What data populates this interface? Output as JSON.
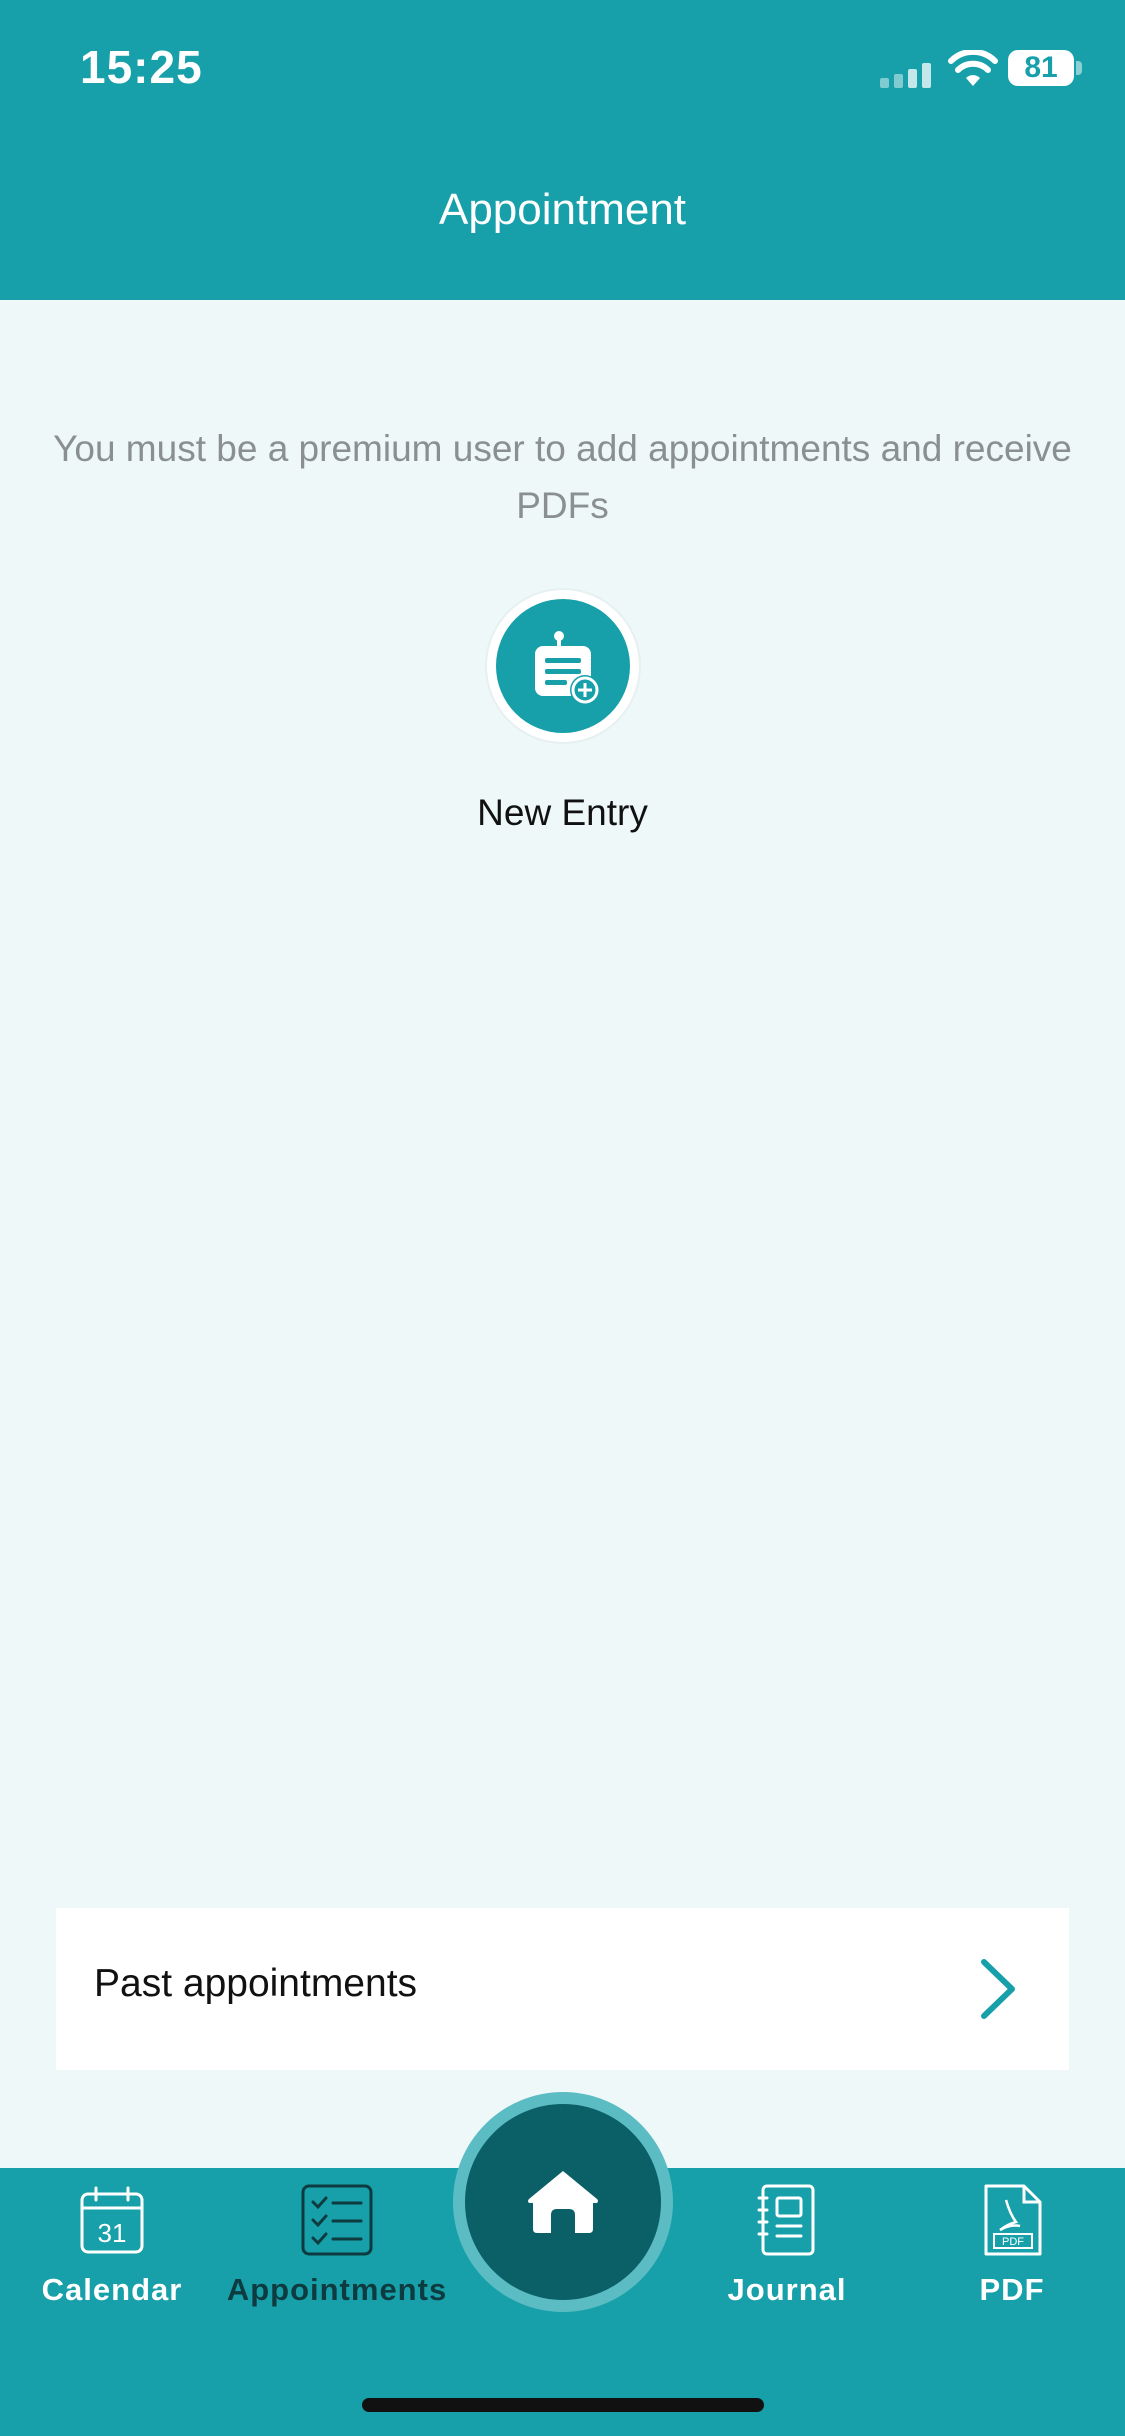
{
  "status_bar": {
    "time": "15:25",
    "battery": "81",
    "signal_icon": "cellular-signal-icon",
    "wifi_icon": "wifi-icon"
  },
  "header": {
    "title": "Appointment",
    "background_color": "#17a0a9"
  },
  "main": {
    "premium_message": "You must be a premium user to add appointments and receive PDFs",
    "new_entry": {
      "label": "New Entry",
      "icon": "clipboard-add-icon"
    },
    "past_appointments": {
      "label": "Past appointments",
      "icon": "chevron-right-icon"
    }
  },
  "tab_bar": {
    "items": [
      {
        "label": "Calendar",
        "icon": "calendar-icon",
        "calendar_day": "31",
        "active": false
      },
      {
        "label": "Appointments",
        "icon": "checklist-icon",
        "active": true
      },
      {
        "label": "Home",
        "icon": "home-icon",
        "active": false
      },
      {
        "label": "Journal",
        "icon": "journal-icon",
        "active": false
      },
      {
        "label": "PDF",
        "icon": "pdf-file-icon",
        "active": false
      }
    ],
    "active_color": "#0d3b40"
  }
}
